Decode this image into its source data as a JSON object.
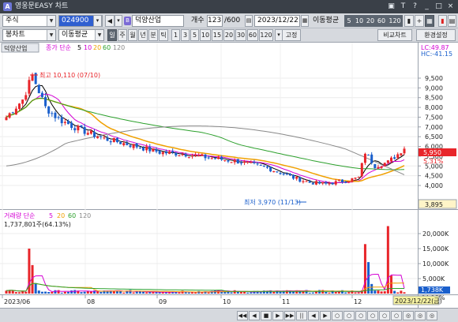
{
  "window": {
    "title": "영웅문EASY 차트",
    "logo": "A",
    "buttons": [
      "▣",
      "T",
      "?",
      "_",
      "□",
      "×"
    ]
  },
  "toolbar1": {
    "market": "주식",
    "code": "024900",
    "stock_name": "덕양산업",
    "count_label": "개수",
    "count_value": "123",
    "count_total": "/600",
    "date": "2023/12/22",
    "ma_label": "이동평균",
    "ma_periods": [
      "5",
      "10",
      "20",
      "60",
      "120"
    ]
  },
  "toolbar2": {
    "chart_type": "봉차트",
    "indicator": "이동평균",
    "periods": [
      "일",
      "주",
      "월",
      "년",
      "분",
      "틱"
    ],
    "minute_options": [
      "1",
      "3",
      "5",
      "10",
      "15",
      "20",
      "30",
      "60",
      "120"
    ],
    "fix_label": "고정",
    "compare_label": "비교차트",
    "settings_label": "환경설정"
  },
  "price_chart": {
    "stock_label": "덕양산업",
    "ma_legend_title": "종가 단순",
    "ma_legend": [
      {
        "label": "5",
        "color": "#000000"
      },
      {
        "label": "10",
        "color": "#d400d4"
      },
      {
        "label": "20",
        "color": "#f0a000"
      },
      {
        "label": "60",
        "color": "#2ca02c"
      },
      {
        "label": "120",
        "color": "#888888"
      }
    ],
    "lc_text": "LC:49.87",
    "hc_text": "HC:-41.15",
    "high_annotation": "최고 10,110 (07/10)",
    "low_annotation": "최저 3,970 (11/13)",
    "current_price": "5,950",
    "change_pct": "5.31%",
    "crosshair_value": "3,895",
    "y_ticks": [
      "9,500",
      "9,000",
      "8,500",
      "8,000",
      "7,500",
      "7,000",
      "6,500",
      "6,000",
      "5,500",
      "5,000",
      "4,500",
      "4,000"
    ],
    "y_ticks_small": [
      "5,500"
    ]
  },
  "volume_chart": {
    "title": "거래량 단순",
    "ma_legend": [
      {
        "label": "5",
        "color": "#d400d4"
      },
      {
        "label": "20",
        "color": "#f0a000"
      },
      {
        "label": "60",
        "color": "#2ca02c"
      },
      {
        "label": "120",
        "color": "#888888"
      }
    ],
    "current_volume": "1,737,801주(64.13%)",
    "y_ticks": [
      "20,000K",
      "15,000K",
      "10,000K",
      "5,000K"
    ],
    "last_volume_tag": "1,738K",
    "last_pct_tag": "64.13%"
  },
  "x_axis": {
    "labels": [
      "2023/06",
      "08",
      "09",
      "10",
      "11",
      "12"
    ],
    "cursor_date": "2023/12/22(금)"
  },
  "colors": {
    "up": "#e8252a",
    "down": "#1a5fcc",
    "ma5": "#000000",
    "ma10": "#d400d4",
    "ma20": "#f0a000",
    "ma60": "#2ca02c",
    "ma120": "#888888"
  },
  "statusbar": {
    "buttons": [
      "◀◀",
      "◀",
      "■",
      "▶",
      "▶▶",
      "||",
      "◀",
      "▶",
      "○",
      "○",
      "○",
      "○",
      "○",
      "○",
      "◎",
      "◎",
      "◎"
    ]
  }
}
